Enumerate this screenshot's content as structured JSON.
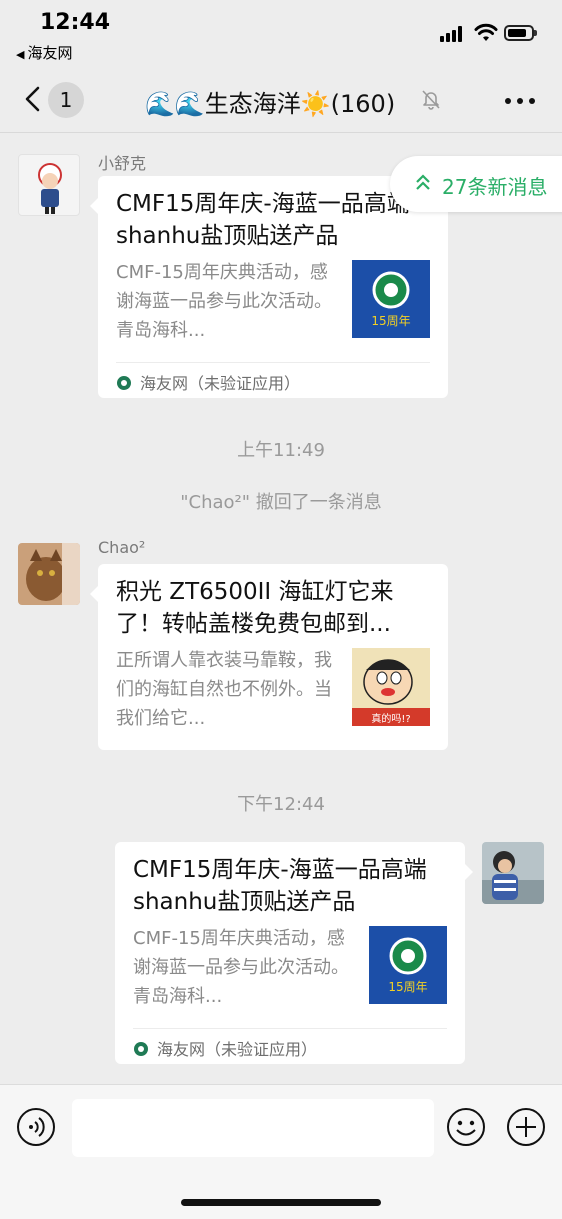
{
  "status_bar": {
    "time": "12:44",
    "back_app": "海友网"
  },
  "nav": {
    "unread_count": "1",
    "title": "🌊🌊生态海洋☀️(160)"
  },
  "new_messages": {
    "text": "27条新消息"
  },
  "messages": [
    {
      "sender": "小舒克",
      "title": "CMF15周年庆-海蓝一品高端shanhu盐顶贴送产品",
      "desc": "CMF-15周年庆典活动，感谢海蓝一品参与此次活动。青岛海科...",
      "source": "海友网（未验证应用）"
    },
    {
      "sender": "Chao²",
      "title": "积光 ZT6500II 海缸灯它来了！转帖盖楼免费包邮到...",
      "desc": "正所谓人靠衣装马靠鞍，我们的海缸自然也不例外。当我们给它...",
      "thumb_caption": "真的吗!?"
    },
    {
      "title": "CMF15周年庆-海蓝一品高端shanhu盐顶贴送产品",
      "desc": "CMF-15周年庆典活动，感谢海蓝一品参与此次活动。青岛海科...",
      "source": "海友网（未验证应用）"
    }
  ],
  "system": {
    "time1": "上午11:49",
    "recall": "\"Chao²\" 撤回了一条消息",
    "time2": "下午12:44"
  },
  "thumb_badge": "15周年",
  "colors": {
    "accent_green": "#2aae67",
    "background": "#ededed"
  }
}
